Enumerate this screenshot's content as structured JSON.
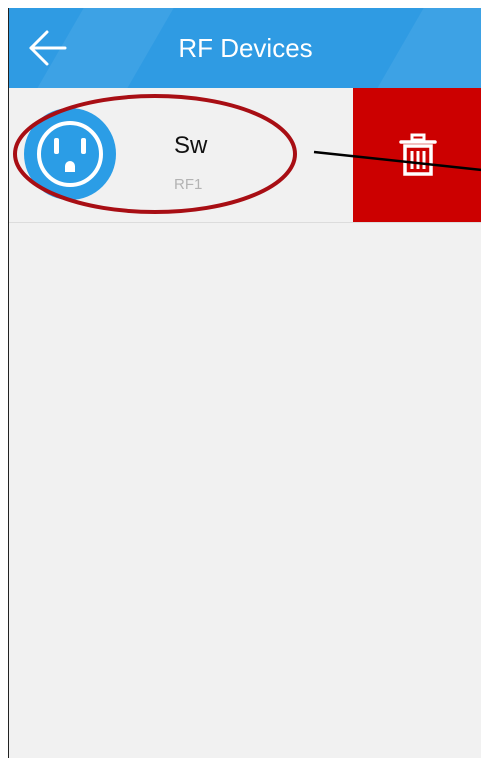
{
  "header": {
    "title": "RF Devices",
    "back_icon": "arrow-left-icon"
  },
  "devices": [
    {
      "name": "Sw",
      "subtitle": "RF1",
      "icon": "power-outlet-icon",
      "swipe_action": {
        "icon": "trash-icon",
        "color": "#cc0000"
      }
    }
  ],
  "colors": {
    "header_bg": "#2f9be3",
    "icon_bg": "#2b9de6",
    "delete_bg": "#cc0000",
    "annotation": "#a80e14"
  }
}
